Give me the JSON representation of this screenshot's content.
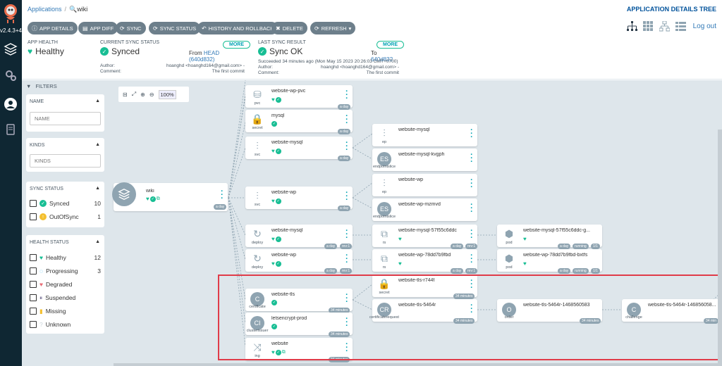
{
  "app": {
    "version": "v2.4.3+4",
    "view_title": "APPLICATION DETAILS TREE"
  },
  "breadcrumb": {
    "root": "Applications",
    "current": "wiki"
  },
  "toolbar": {
    "buttons": [
      "APP DETAILS",
      "APP DIFF",
      "SYNC",
      "SYNC STATUS",
      "HISTORY AND ROLLBACK",
      "DELETE",
      "REFRESH"
    ],
    "logout": "Log out"
  },
  "status": {
    "health": {
      "label": "APP HEALTH",
      "value": "Healthy"
    },
    "sync": {
      "label": "CURRENT SYNC STATUS",
      "value": "Synced",
      "more": "MORE",
      "from_prefix": "From",
      "branch": "HEAD",
      "commit": "(640d832)",
      "author_label": "Author:",
      "author": "hoanghd <hoanghd164@gmail.com> -",
      "comment_label": "Comment:",
      "comment": "The first commit"
    },
    "last_sync": {
      "label": "LAST SYNC RESULT",
      "value": "Sync OK",
      "more": "MORE",
      "to_prefix": "To",
      "commit": "640d832",
      "succeeded": "Succeeded 34 minutes ago (Mon May 15 2023 20:26:03 GMT+0700)",
      "author_label": "Author:",
      "author": "hoanghd <hoanghd164@gmail.com> -",
      "comment_label": "Comment:",
      "comment": "The first commit"
    }
  },
  "filters": {
    "title": "FILTERS",
    "name": {
      "title": "NAME",
      "placeholder": "NAME"
    },
    "kinds": {
      "title": "KINDS",
      "placeholder": "KINDS"
    },
    "sync_status": {
      "title": "SYNC STATUS",
      "items": [
        {
          "label": "Synced",
          "count": "10"
        },
        {
          "label": "OutOfSync",
          "count": "1"
        }
      ]
    },
    "health_status": {
      "title": "HEALTH STATUS",
      "items": [
        {
          "label": "Healthy",
          "count": "12"
        },
        {
          "label": "Progressing",
          "count": "3"
        },
        {
          "label": "Degraded",
          "count": ""
        },
        {
          "label": "Suspended",
          "count": ""
        },
        {
          "label": "Missing",
          "count": ""
        },
        {
          "label": "Unknown",
          "count": ""
        }
      ]
    }
  },
  "zoom": {
    "value": "100%"
  },
  "nodes": {
    "root": {
      "name": "wiki",
      "tag": "a day"
    },
    "wp_pvc": {
      "name": "website-wp-pvc",
      "kind": "pvc",
      "tag": "a day"
    },
    "mysql_secret": {
      "name": "mysql",
      "kind": "secret",
      "tag": "a day"
    },
    "mysql_svc": {
      "name": "website-mysql",
      "kind": "svc",
      "tag": "a day"
    },
    "wp_svc": {
      "name": "website-wp",
      "kind": "svc",
      "tag": "a day"
    },
    "mysql_deploy": {
      "name": "website-mysql",
      "kind": "deploy",
      "tag": "a day",
      "rev": "rev:1"
    },
    "wp_deploy": {
      "name": "website-wp",
      "kind": "deploy",
      "tag": "a day",
      "rev": "rev:1"
    },
    "tls_cert": {
      "name": "website-tls",
      "kind": "certificate",
      "tag": "34 minutes"
    },
    "issuer": {
      "name": "letsencrypt-prod",
      "kind": "clusterissuer",
      "tag": "34 minutes"
    },
    "ing": {
      "name": "website",
      "kind": "ing",
      "tag": "34 minutes"
    },
    "mysql_ep": {
      "name": "website-mysql",
      "kind": "ep"
    },
    "mysql_es": {
      "name": "website-mysql-kvgph",
      "kind": "endpointslice"
    },
    "wp_ep": {
      "name": "website-wp",
      "kind": "ep"
    },
    "wp_es": {
      "name": "website-wp-mzmvd",
      "kind": "endpointslice"
    },
    "mysql_rs": {
      "name": "website-mysql-57f55c6ddc",
      "kind": "rs",
      "tag": "a day",
      "rev": "rev:1"
    },
    "wp_rs": {
      "name": "website-wp-78dd7b9fbd",
      "kind": "rs",
      "tag": "a day",
      "rev": "rev:1"
    },
    "tls_secret": {
      "name": "website-tls-r744f",
      "kind": "secret",
      "tag": "34 minutes"
    },
    "tls_cr": {
      "name": "website-tls-5464r",
      "kind": "certificaterequest",
      "tag": "34 minutes"
    },
    "mysql_pod": {
      "name": "website-mysql-57f55c6ddc-g...",
      "kind": "pod",
      "tag": "a day",
      "run": "running",
      "ratio": "1/1"
    },
    "wp_pod": {
      "name": "website-wp-78dd7b9fbd-bxtfs",
      "kind": "pod",
      "tag": "a day",
      "run": "running",
      "ratio": "1/1"
    },
    "order": {
      "name": "website-tls-5464r-1468560583",
      "kind": "order",
      "tag": "34 minutes"
    },
    "challenge": {
      "name": "website-tls-5464r-146856058...",
      "kind": "challenge",
      "tag": "34 min"
    }
  }
}
